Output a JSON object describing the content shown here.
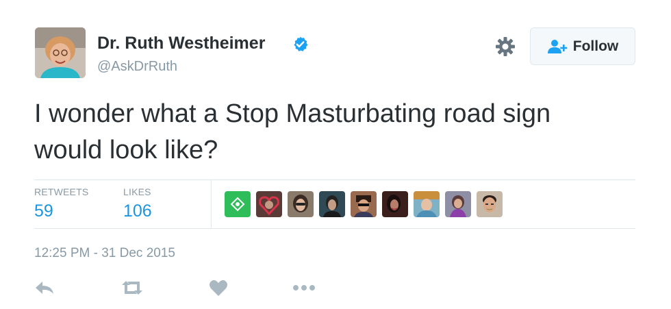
{
  "author": {
    "display_name": "Dr. Ruth Westheimer",
    "screen_name": "@AskDrRuth",
    "verified": true,
    "avatar_icon": "profile-photo"
  },
  "header": {
    "settings_icon": "gear-icon",
    "follow_label": "Follow",
    "follow_icon": "add-user-icon"
  },
  "tweet": {
    "text": "I wonder what a Stop Masturbating road sign would look like?"
  },
  "stats": {
    "retweets_label": "RETWEETS",
    "retweets_count": "59",
    "likes_label": "LIKES",
    "likes_count": "106"
  },
  "likers": [
    {
      "name": "liker-avatar-1"
    },
    {
      "name": "liker-avatar-2"
    },
    {
      "name": "liker-avatar-3"
    },
    {
      "name": "liker-avatar-4"
    },
    {
      "name": "liker-avatar-5"
    },
    {
      "name": "liker-avatar-6"
    },
    {
      "name": "liker-avatar-7"
    },
    {
      "name": "liker-avatar-8"
    },
    {
      "name": "liker-avatar-9"
    }
  ],
  "timestamp": "12:25 PM - 31 Dec 2015",
  "actions": [
    "reply-icon",
    "retweet-icon",
    "heart-icon",
    "more-icon"
  ],
  "colors": {
    "link_blue": "#1b95e0",
    "verified_blue": "#1da1f2",
    "text_dark": "#292f33",
    "text_muted": "#8899a6",
    "border": "#e1e8ed",
    "icon_gray": "#aab8c2"
  }
}
